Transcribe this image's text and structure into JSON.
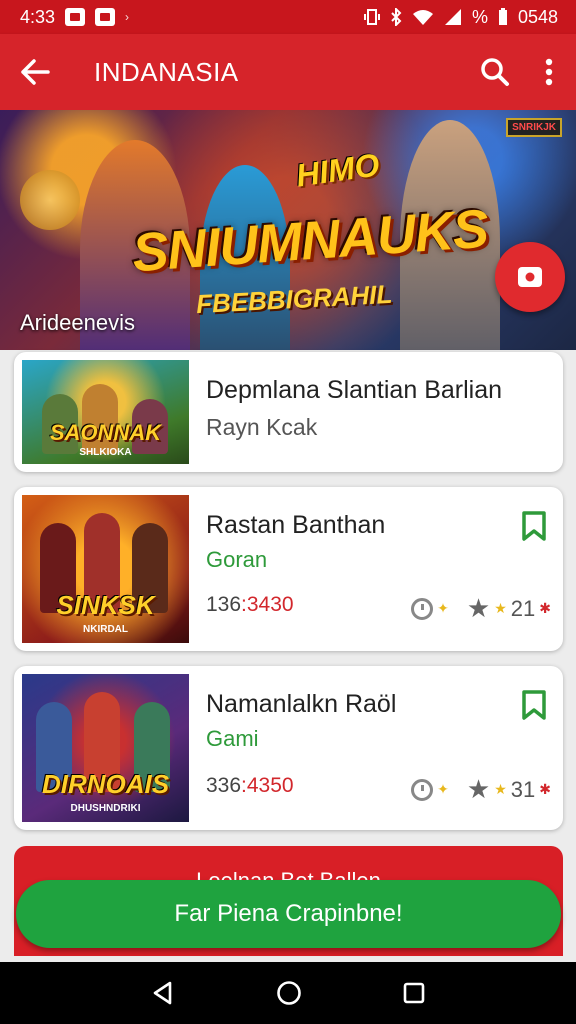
{
  "status_bar": {
    "time": "4:33",
    "right_text": "0548",
    "battery_text": "%"
  },
  "app_bar": {
    "title": "INDANASIA"
  },
  "hero": {
    "logo_small": "HIMO",
    "logo_big": "SNIUMNAUKS",
    "logo_sub": "FBEBBIGRAHIL",
    "badge": "SNRIKJK",
    "caption": "Arideenevis"
  },
  "cards": [
    {
      "thumb_label": "SAONNAK",
      "thumb_sub": "SHLKIOKA",
      "title": "Depmlana Slantian Barlian",
      "subtitle": "Rayn Kcak"
    },
    {
      "thumb_label": "SINKSK",
      "thumb_sub": "NKIRDAL",
      "title": "Rastan Banthan",
      "subtitle": "Goran",
      "meta_gray": "136",
      "meta_red": ":3430",
      "rating": "21"
    },
    {
      "thumb_label": "DIRNOAIS",
      "thumb_sub": "DHUSHNDRIKI",
      "title": "Namanlalkn Raöl",
      "subtitle": "Gami",
      "meta_gray": "336",
      "meta_red": ":4350",
      "rating": "31"
    }
  ],
  "buttons": {
    "red_label": "Loelnan Bet Ballen",
    "green_label": "Far Piena Crapinbne!"
  },
  "colors": {
    "primary_red": "#d6242a",
    "status_red": "#c8161d",
    "green": "#1fa33f",
    "rating_star": "#e8b81d"
  }
}
